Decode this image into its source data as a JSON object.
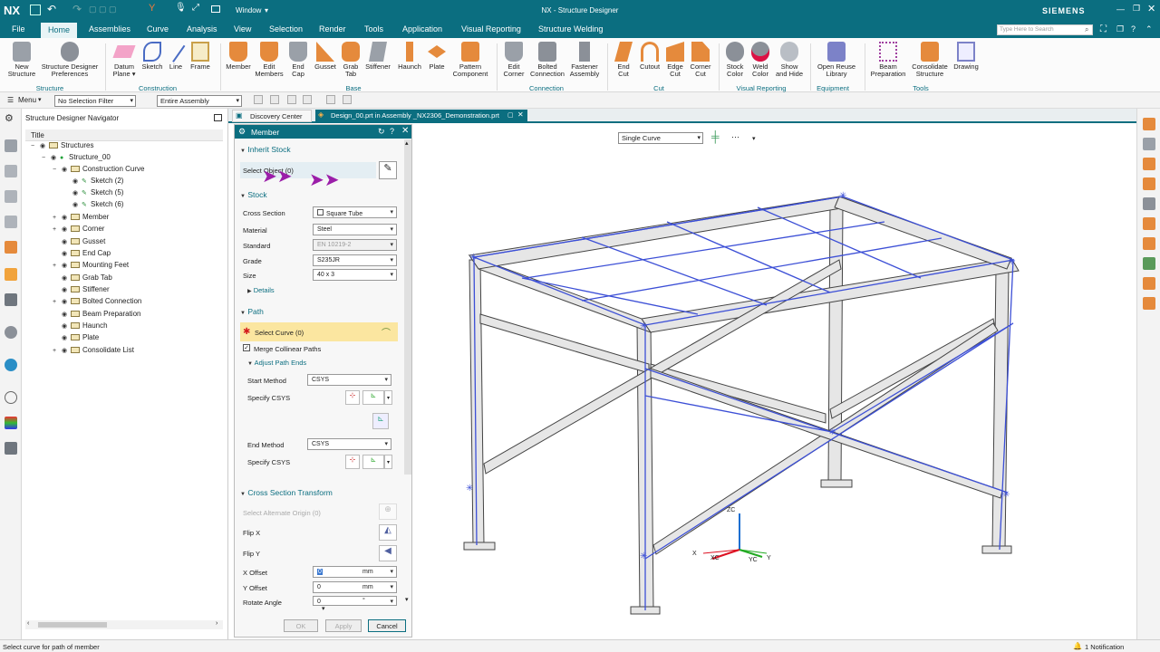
{
  "app": {
    "logo": "NX",
    "window_menu": "Window",
    "title": "NX - Structure Designer",
    "brand": "SIEMENS",
    "search_placeholder": "Type Here to Search"
  },
  "menubar": [
    "File",
    "Home",
    "Assemblies",
    "Curve",
    "Analysis",
    "View",
    "Selection",
    "Render",
    "Tools",
    "Application",
    "Visual Reporting",
    "Structure Welding"
  ],
  "ribbon": {
    "buttons": [
      {
        "label": "New\nStructure"
      },
      {
        "label": "Structure Designer\nPreferences"
      },
      {
        "label": "Datum\nPlane ▾"
      },
      {
        "label": "Sketch"
      },
      {
        "label": "Line"
      },
      {
        "label": "Frame"
      },
      {
        "label": "Member"
      },
      {
        "label": "Edit\nMembers"
      },
      {
        "label": "End\nCap"
      },
      {
        "label": "Gusset"
      },
      {
        "label": "Grab\nTab"
      },
      {
        "label": "Stiffener"
      },
      {
        "label": "Haunch"
      },
      {
        "label": "Plate"
      },
      {
        "label": "Pattern\nComponent"
      },
      {
        "label": "Edit\nCorner"
      },
      {
        "label": "Bolted\nConnection"
      },
      {
        "label": "Fastener\nAssembly"
      },
      {
        "label": "End\nCut"
      },
      {
        "label": "Cutout"
      },
      {
        "label": "Edge\nCut"
      },
      {
        "label": "Corner\nCut"
      },
      {
        "label": "Stock\nColor"
      },
      {
        "label": "Weld\nColor"
      },
      {
        "label": "Show\nand Hide"
      },
      {
        "label": "Open Reuse\nLibrary"
      },
      {
        "label": "Beam\nPreparation"
      },
      {
        "label": "Consolidate\nStructure"
      },
      {
        "label": "Drawing"
      }
    ],
    "groups": [
      "Structure",
      "Construction",
      "Base",
      "Connection",
      "Cut",
      "Visual Reporting",
      "Equipment",
      "Tools"
    ]
  },
  "toolbar": {
    "menu_label": "Menu",
    "selection_filter": "No Selection Filter",
    "assembly_scope": "Entire Assembly"
  },
  "navigator": {
    "title": "Structure Designer Navigator",
    "column": "Title",
    "items": [
      "Structures",
      "Structure_00",
      "Construction Curve",
      "Sketch (2)",
      "Sketch (5)",
      "Sketch (6)",
      "Member",
      "Corner",
      "Gusset",
      "End Cap",
      "Mounting Feet",
      "Grab Tab",
      "Stiffener",
      "Bolted Connection",
      "Beam Preparation",
      "Haunch",
      "Plate",
      "Consolidate List"
    ]
  },
  "tabs": [
    "Discovery Center",
    "Design_00.prt in Assembly _NX2306_Demonstration.prt"
  ],
  "dialog": {
    "title": "Member",
    "inherit_stock": "Inherit Stock",
    "select_object": "Select Object (0)",
    "stock": "Stock",
    "cross_section_label": "Cross Section",
    "cross_section": "Square Tube",
    "material_label": "Material",
    "material": "Steel",
    "standard_label": "Standard",
    "standard": "EN 10219-2",
    "grade_label": "Grade",
    "grade": "S235JR",
    "size_label": "Size",
    "size": "40 x 3",
    "details": "Details",
    "path": "Path",
    "select_curve": "Select Curve (0)",
    "merge_collinear": "Merge Collinear Paths",
    "adjust_path_ends": "Adjust Path Ends",
    "start_method_label": "Start Method",
    "start_method": "CSYS",
    "specify_csys": "Specify CSYS",
    "end_method_label": "End Method",
    "end_method": "CSYS",
    "cross_section_transform": "Cross Section Transform",
    "select_alt_origin": "Select Alternate Origin (0)",
    "flip_x": "Flip X",
    "flip_y": "Flip Y",
    "x_offset_label": "X Offset",
    "x_offset": "0",
    "y_offset_label": "Y Offset",
    "y_offset": "0",
    "rotate_label": "Rotate Angle",
    "rotate": "0",
    "unit_mm": "mm",
    "unit_deg": "°",
    "ok": "OK",
    "apply": "Apply",
    "cancel": "Cancel"
  },
  "viewport": {
    "curve_rule": "Single Curve",
    "axis_zc": "ZC",
    "axis_x": "X",
    "axis_xc": "XC",
    "axis_yc": "YC",
    "axis_y": "Y"
  },
  "status": {
    "message": "Select curve for path of member",
    "notifications": "1 Notification"
  },
  "colors": {
    "accent": "#0b6e80",
    "highlight": "#fbe6a0",
    "frame_blue": "#3c4fd6"
  }
}
